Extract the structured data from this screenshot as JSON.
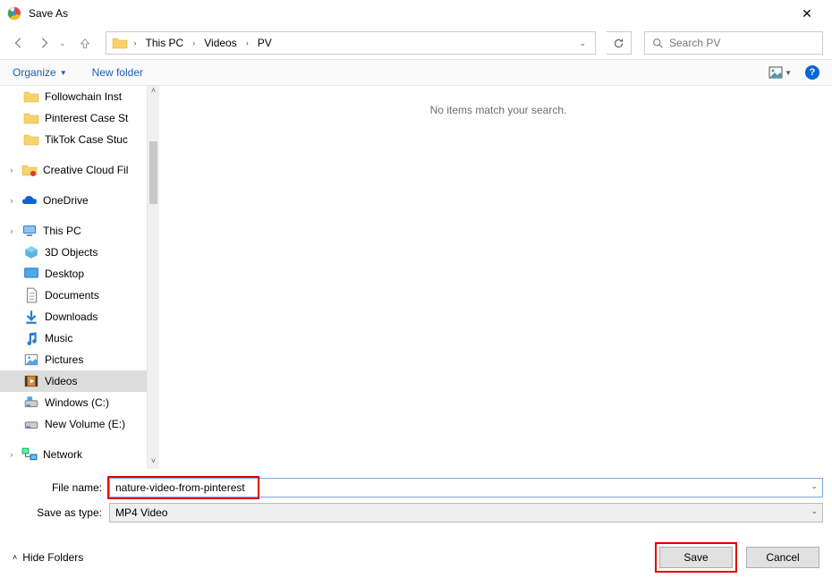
{
  "title": "Save As",
  "breadcrumb": [
    "This PC",
    "Videos",
    "PV"
  ],
  "search_placeholder": "Search PV",
  "toolbar": {
    "organize": "Organize",
    "new_folder": "New folder"
  },
  "content_empty": "No items match your search.",
  "tree": {
    "quick_access_children": [
      "Followchain Inst",
      "Pinterest Case St",
      "TikTok Case Stuc"
    ],
    "creative_cloud": "Creative Cloud Fil",
    "onedrive": "OneDrive",
    "this_pc": "This PC",
    "this_pc_children": [
      {
        "label": "3D Objects",
        "icon": "3d"
      },
      {
        "label": "Desktop",
        "icon": "desktop"
      },
      {
        "label": "Documents",
        "icon": "documents"
      },
      {
        "label": "Downloads",
        "icon": "downloads"
      },
      {
        "label": "Music",
        "icon": "music"
      },
      {
        "label": "Pictures",
        "icon": "pictures"
      },
      {
        "label": "Videos",
        "icon": "videos",
        "selected": true
      },
      {
        "label": "Windows (C:)",
        "icon": "drive-c"
      },
      {
        "label": "New Volume (E:)",
        "icon": "drive"
      }
    ],
    "network": "Network"
  },
  "form": {
    "filename_label": "File name:",
    "filename_value": "nature-video-from-pinterest",
    "type_label": "Save as type:",
    "type_value": "MP4 Video"
  },
  "footer": {
    "hide_folders": "Hide Folders",
    "save": "Save",
    "cancel": "Cancel"
  }
}
